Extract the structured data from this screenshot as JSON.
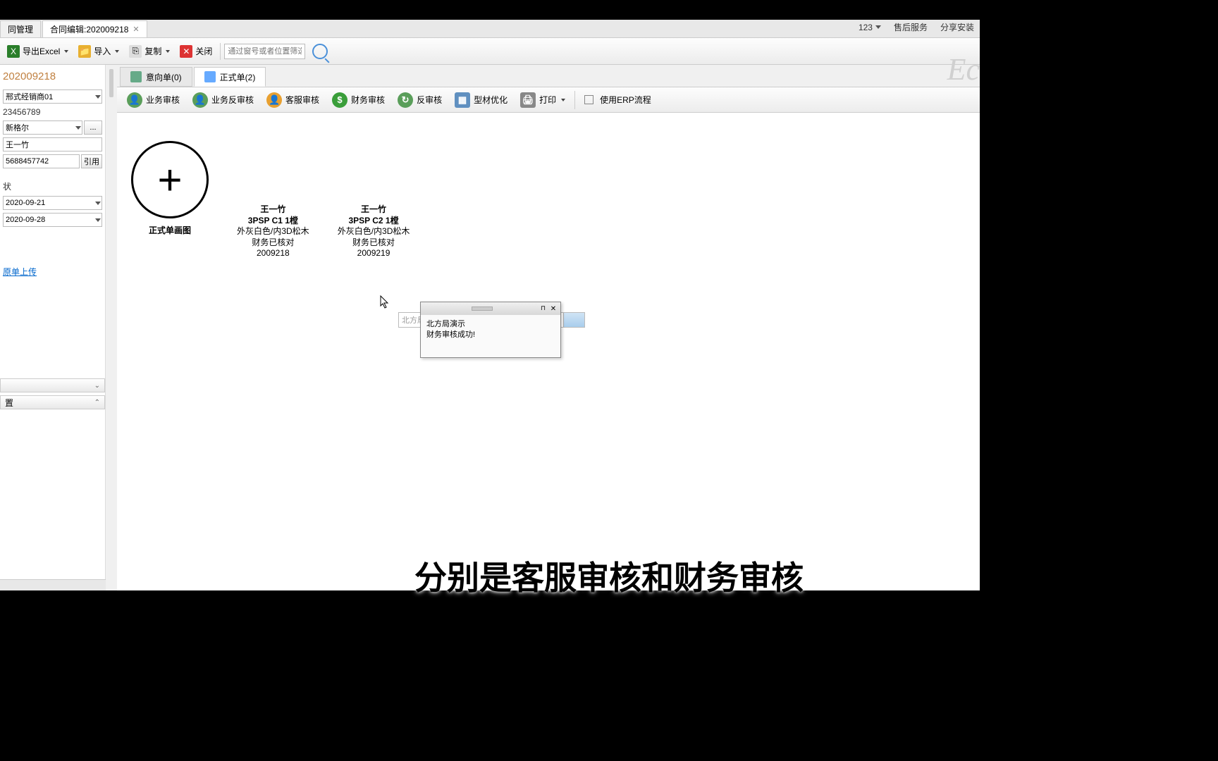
{
  "topRight": {
    "user": "123",
    "link1": "售后服务",
    "link2": "分享安装"
  },
  "tabs": {
    "tab1": "同管理",
    "tab2": "合同编辑:202009218"
  },
  "toolbar": {
    "exportExcel": "导出Excel",
    "import": "导入",
    "copy": "复制",
    "close": "关闭",
    "searchPlaceholder": "通过窗号或者位置筛选"
  },
  "leftPanel": {
    "contractId": "202009218",
    "dealer": "邢式经销商01",
    "phone1": "23456789",
    "brand": "新格尔",
    "customer": "王一竹",
    "phone2": "5688457742",
    "quoteBtn": "引用",
    "ellipsis": "...",
    "stateLabel": "状",
    "date1": "2020-09-21",
    "date2": "2020-09-28",
    "uploadLink": "原单上传",
    "section2": "置"
  },
  "contentTabs": {
    "tab1": "意向单(0)",
    "tab2": "正式单(2)"
  },
  "actions": {
    "bizAudit": "业务审核",
    "bizReverse": "业务反审核",
    "csAudit": "客服审核",
    "finAudit": "财务审核",
    "reverseAudit": "反审核",
    "profileOpt": "型材优化",
    "print": "打印",
    "useERP": "使用ERP流程"
  },
  "canvas": {
    "addLabel": "正式单画图",
    "item1": {
      "name": "王一竹",
      "code": "3PSP C1 1樘",
      "color": "外灰白色/内3D松木",
      "status": "财务已核对",
      "num": "2009218"
    },
    "item2": {
      "name": "王一竹",
      "code": "3PSP C2 1樘",
      "color": "外灰白色/内3D松木",
      "status": "财务已核对",
      "num": "2009219"
    }
  },
  "popup": {
    "bgText": "北方局",
    "line1": "北方局演示",
    "line2": "财务审核成功!"
  },
  "subtitle": "分别是客服审核和财务审核",
  "watermark": "Ec"
}
